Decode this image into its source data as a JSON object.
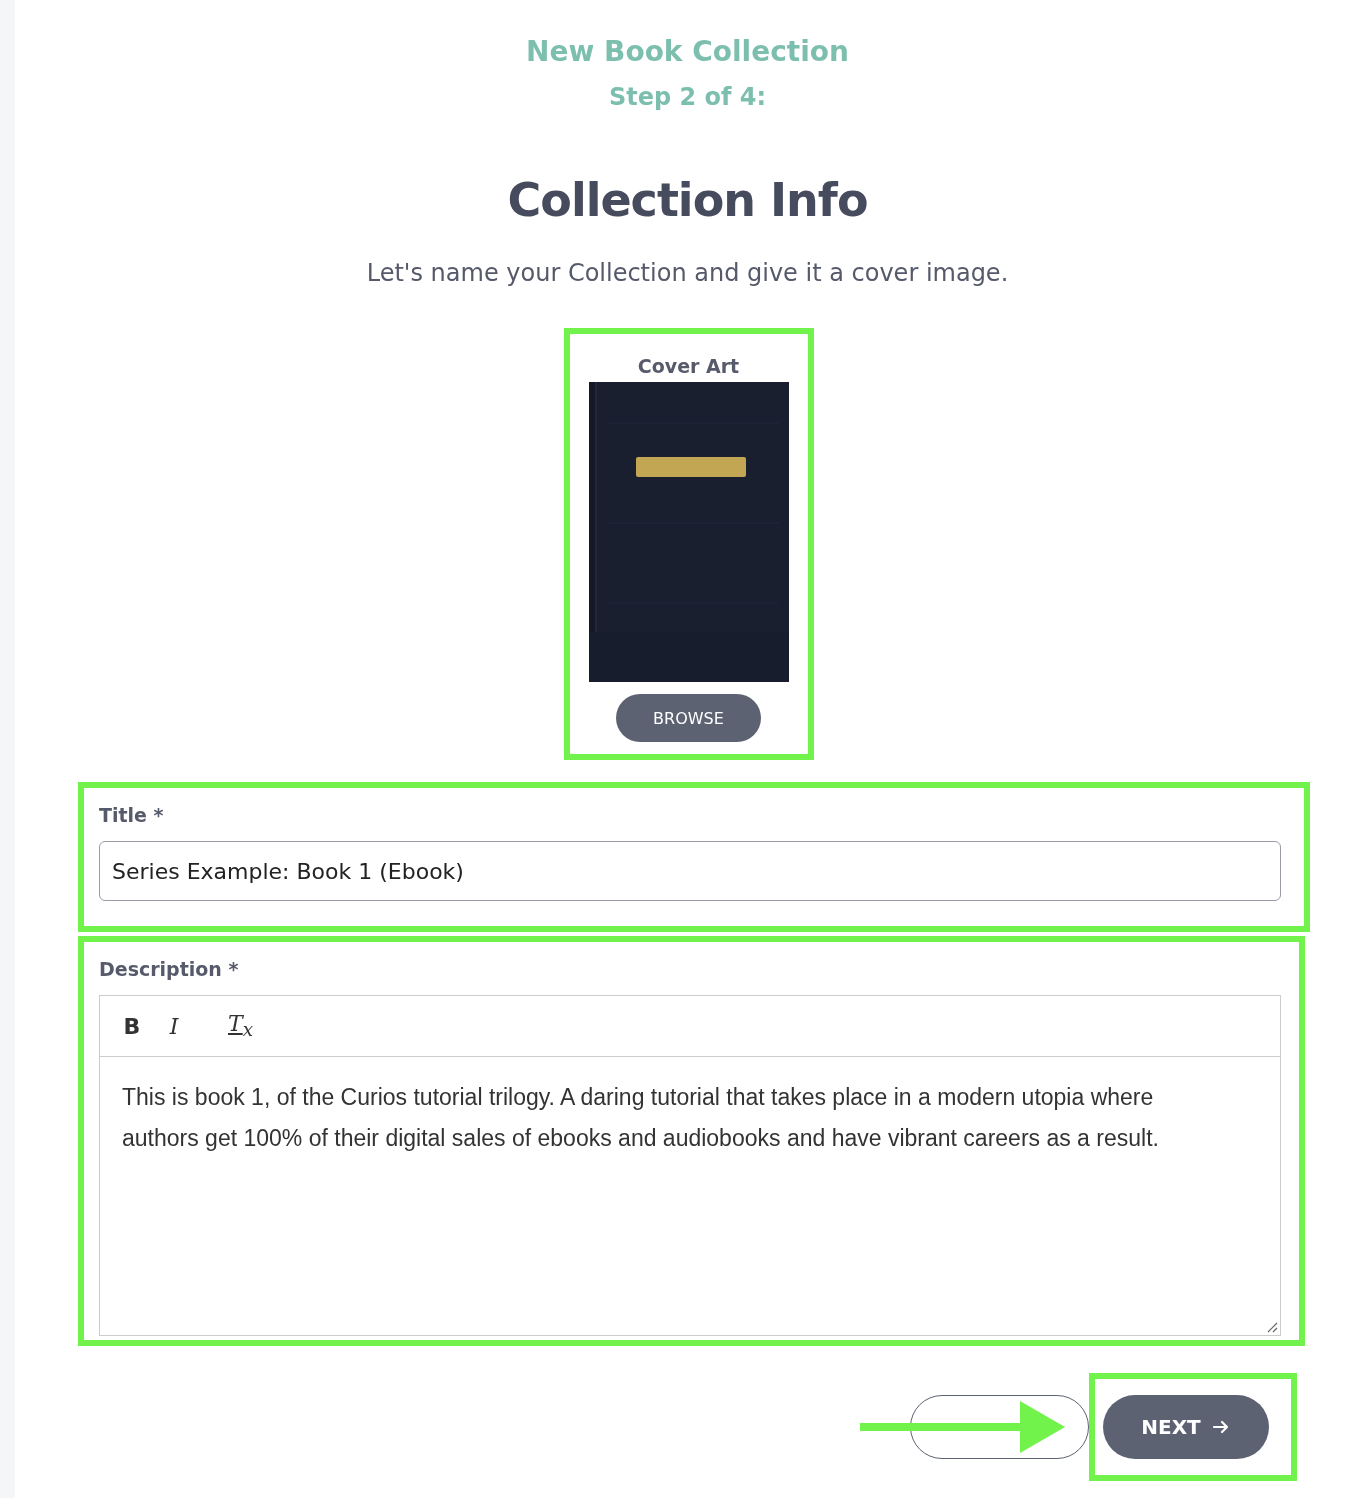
{
  "header": {
    "title": "New Book Collection",
    "step": "Step 2 of 4:"
  },
  "heading": "Collection Info",
  "subtitle": "Let's name your Collection and give it a cover image.",
  "cover_art": {
    "label": "Cover Art",
    "button": "BROWSE",
    "highlighted": true
  },
  "title_field": {
    "label": "Title *",
    "value": "Series Example: Book 1 (Ebook)",
    "highlighted": true
  },
  "description": {
    "label": "Description *",
    "toolbar": [
      {
        "kind": "bold",
        "label": "B"
      },
      {
        "kind": "italic",
        "label": "I"
      },
      {
        "kind": "clear",
        "label": "T$_{x}$"
      }
    ],
    "value": "This is book 1, of the Curios tutorial trilogy. A daring tutorial that takes place in a modern utopia where authors get 100% of their digital sales of ebooks and audiobooks and have vibrant careers as a result.",
    "highlighted": true
  },
  "buttons": {
    "back": {
      "kind": "outline"
    },
    "next": "NEXT",
    "next_highlighted": true
  },
  "pointer_arrow": true
}
